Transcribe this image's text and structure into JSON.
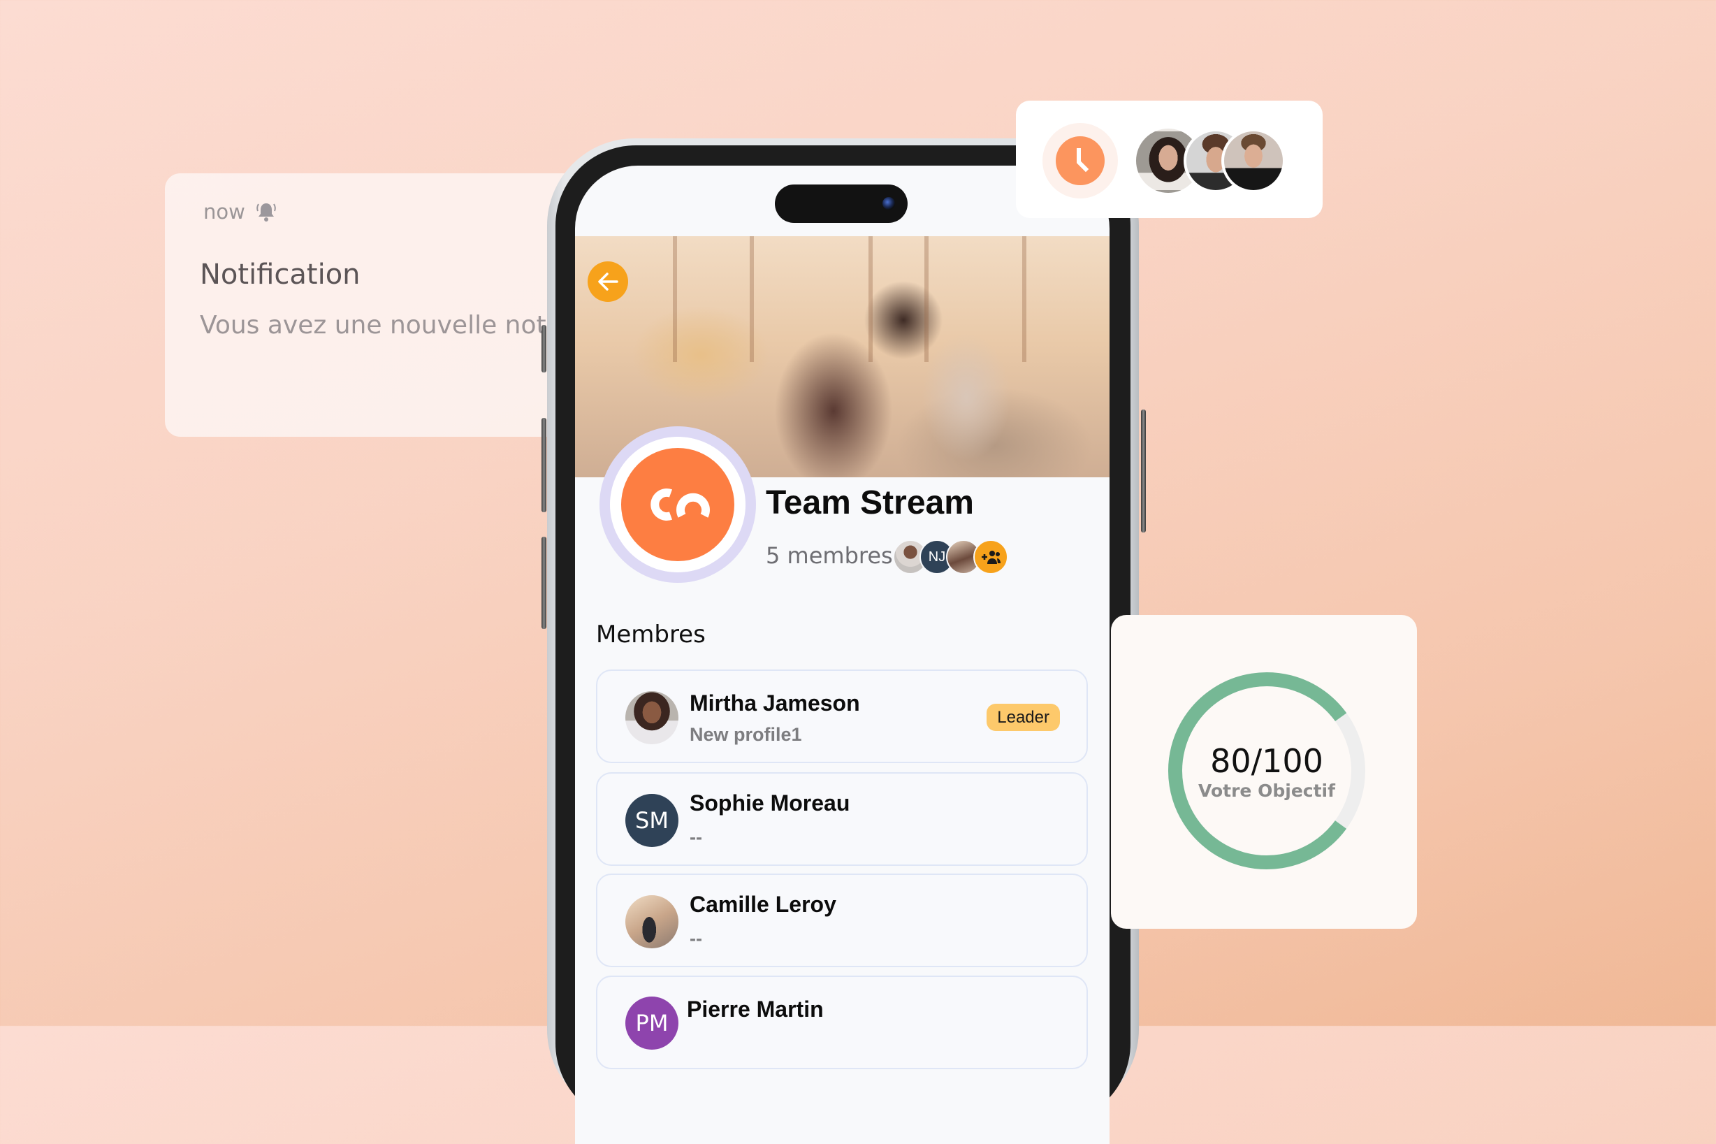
{
  "notification": {
    "time": "now",
    "bell_icon": "bell-ringing-icon",
    "title": "Notification",
    "body": "Vous avez une nouvelle notif"
  },
  "phone": {
    "back_icon": "arrow-left-icon",
    "team": {
      "logo_text": "co",
      "name": "Team Stream",
      "member_count_label": "5 membres",
      "preview_avatars": [
        {
          "type": "photo",
          "initials": ""
        },
        {
          "type": "initials",
          "initials": "NJ",
          "color": "#2f4257"
        },
        {
          "type": "photo",
          "initials": ""
        },
        {
          "type": "action",
          "icon": "add-group-icon",
          "color": "#f7a21b"
        }
      ]
    },
    "section_title": "Membres",
    "members": [
      {
        "name": "Mirtha Jameson",
        "subtitle": "New profile1",
        "avatar_type": "photo",
        "initials": "",
        "badge": "Leader"
      },
      {
        "name": "Sophie Moreau",
        "subtitle": "--",
        "avatar_type": "initials",
        "initials": "SM",
        "avatar_color": "#2f4257",
        "badge": ""
      },
      {
        "name": "Camille Leroy",
        "subtitle": "--",
        "avatar_type": "photo",
        "initials": "",
        "badge": ""
      },
      {
        "name": "Pierre Martin",
        "subtitle": "",
        "avatar_type": "initials",
        "initials": "PM",
        "avatar_color": "#8e44ad",
        "badge": ""
      }
    ]
  },
  "time_card": {
    "icon": "clock-icon",
    "avatars": [
      "photo-woman",
      "photo-man-smiling",
      "photo-man-hoodie"
    ]
  },
  "goal": {
    "value_label": "80/100",
    "caption": "Votre Objectif",
    "progress": 0.8,
    "colors": {
      "progress": "#76b895",
      "track": "#eeeeee"
    }
  },
  "colors": {
    "accent_orange": "#fd7e42",
    "back_button": "#f7a21b",
    "leader_badge": "#fdc96b"
  }
}
